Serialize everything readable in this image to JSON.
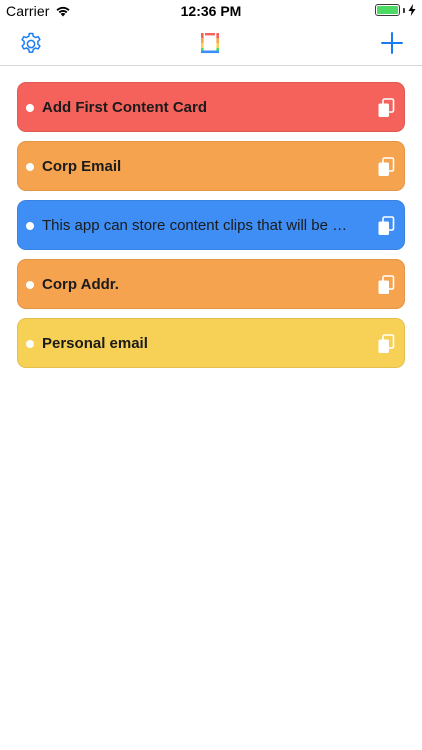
{
  "status_bar": {
    "carrier": "Carrier",
    "time": "12:36 PM",
    "wifi_icon": "wifi-icon",
    "battery_icon": "battery-icon",
    "charging_icon": "charging-bolt-icon",
    "battery_level": 1.0
  },
  "nav": {
    "settings_icon": "gear-icon",
    "logo_icon": "app-logo-icon",
    "add_icon": "plus-icon",
    "accent_color": "#1a7cf5"
  },
  "cards": [
    {
      "label": "Add First Content Card",
      "color": "#f5615b",
      "bold": true,
      "copy_icon": "copy-icon"
    },
    {
      "label": "Corp Email",
      "color": "#f5a34f",
      "bold": true,
      "copy_icon": "copy-icon"
    },
    {
      "label": "This app can store content clips that will be us...",
      "color": "#3f8ef5",
      "bold": false,
      "copy_icon": "copy-icon"
    },
    {
      "label": "Corp Addr.",
      "color": "#f5a34f",
      "bold": true,
      "copy_icon": "copy-icon"
    },
    {
      "label": "Personal email",
      "color": "#f7d155",
      "bold": true,
      "copy_icon": "copy-icon"
    }
  ]
}
